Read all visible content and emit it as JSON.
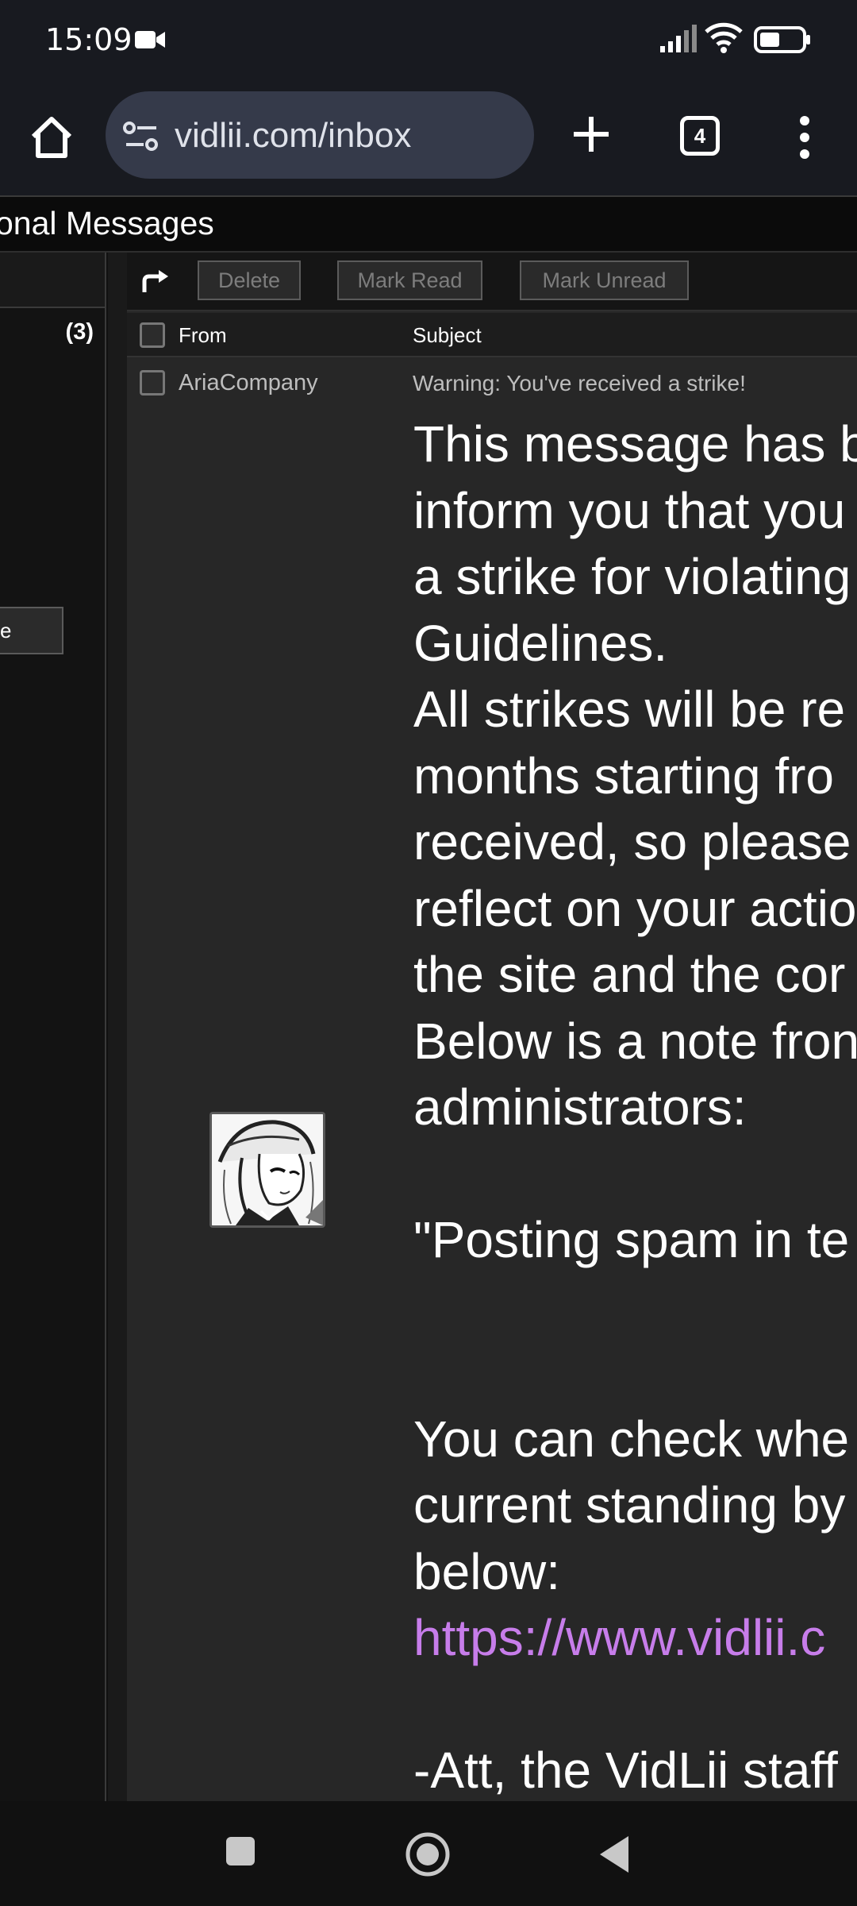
{
  "status_bar": {
    "time": "15:09",
    "icons": [
      "video-camera-icon",
      "signal-icon",
      "wifi-icon",
      "battery-icon"
    ]
  },
  "browser": {
    "url": "vidlii.com/inbox",
    "tab_count": "4",
    "icons": [
      "home-icon",
      "site-settings-icon",
      "plus-icon",
      "tabs-icon",
      "more-vert-icon"
    ]
  },
  "page": {
    "title": "onal Messages",
    "inbox_count": "(3)",
    "left_button_label": "e"
  },
  "toolbar": {
    "forward_icon": "forward-arrow-icon",
    "delete_label": "Delete",
    "mark_read_label": "Mark Read",
    "mark_unread_label": "Mark Unread"
  },
  "table": {
    "columns": [
      "From",
      "Subject"
    ],
    "rows": [
      {
        "from": "AriaCompany",
        "subject": "Warning: You've received a strike!"
      }
    ]
  },
  "message": {
    "lines": [
      "This message has b",
      "inform you that you",
      "a strike for violating",
      "Guidelines.",
      "All strikes will be re",
      "months starting fro",
      "received, so please",
      "reflect on your actio",
      "the site and the cor",
      "Below is a note fron",
      "administrators:",
      "",
      "\"Posting spam in te",
      "",
      "",
      "You can check whe",
      "current standing by",
      "below:",
      "https://www.vidlii.c",
      "",
      "-Att, the VidLii staff"
    ],
    "link_color": "#c77dea"
  },
  "nav_bar": {
    "icons": [
      "recents-icon",
      "home-icon",
      "back-icon"
    ]
  }
}
